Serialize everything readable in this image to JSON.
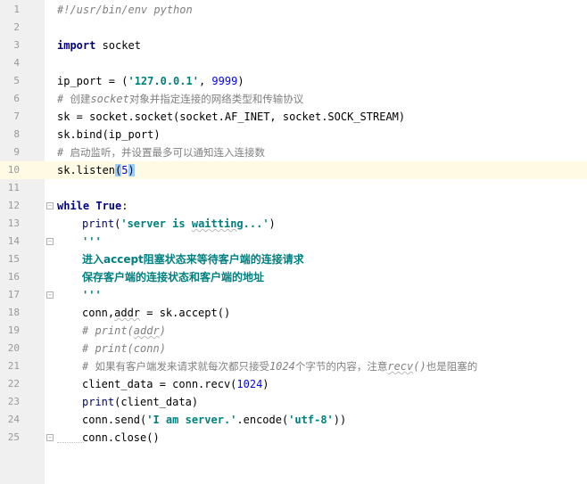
{
  "editor": {
    "current_line": 10,
    "lines": [
      {
        "n": "1",
        "tokens": [
          {
            "t": "#!/usr/bin/env python",
            "c": "cmt"
          }
        ]
      },
      {
        "n": "2",
        "tokens": []
      },
      {
        "n": "3",
        "tokens": [
          {
            "t": "import",
            "c": "kw"
          },
          {
            "t": " socket",
            "c": "plain"
          }
        ]
      },
      {
        "n": "4",
        "tokens": []
      },
      {
        "n": "5",
        "tokens": [
          {
            "t": "ip_port = (",
            "c": "plain"
          },
          {
            "t": "'127.0.0.1'",
            "c": "str"
          },
          {
            "t": ", ",
            "c": "plain"
          },
          {
            "t": "9999",
            "c": "num"
          },
          {
            "t": ")",
            "c": "plain"
          }
        ]
      },
      {
        "n": "6",
        "tokens": [
          {
            "t": "# ",
            "c": "cmt"
          },
          {
            "t": "创建",
            "c": "cmt-cn"
          },
          {
            "t": "socket",
            "c": "cmt"
          },
          {
            "t": "对象并指定连接的网络类型和传输协议",
            "c": "cmt-cn"
          }
        ]
      },
      {
        "n": "7",
        "tokens": [
          {
            "t": "sk = socket.socket(socket.AF_INET, socket.SOCK_STREAM)",
            "c": "plain"
          }
        ]
      },
      {
        "n": "8",
        "tokens": [
          {
            "t": "sk.bind(ip_port)",
            "c": "plain"
          }
        ]
      },
      {
        "n": "9",
        "tokens": [
          {
            "t": "# ",
            "c": "cmt"
          },
          {
            "t": "启动监听，并设置最多可以通知连入连接数",
            "c": "cmt-cn"
          }
        ]
      },
      {
        "n": "10",
        "tokens": [
          {
            "t": "sk.listen",
            "c": "plain"
          },
          {
            "t": "(",
            "c": "plain hl-paren"
          },
          {
            "t": "5",
            "c": "num"
          },
          {
            "t": ")",
            "c": "plain hl-paren"
          }
        ]
      },
      {
        "n": "11",
        "tokens": []
      },
      {
        "n": "12",
        "tokens": [
          {
            "t": "while",
            "c": "kw"
          },
          {
            "t": " ",
            "c": "plain"
          },
          {
            "t": "True",
            "c": "kw"
          },
          {
            "t": ":",
            "c": "plain"
          }
        ]
      },
      {
        "n": "13",
        "indent": 1,
        "tokens": [
          {
            "t": "print",
            "c": "builtin"
          },
          {
            "t": "(",
            "c": "plain"
          },
          {
            "t": "'server is ",
            "c": "str"
          },
          {
            "t": "waitting",
            "c": "str squiggle"
          },
          {
            "t": "...'",
            "c": "str"
          },
          {
            "t": ")",
            "c": "plain"
          }
        ]
      },
      {
        "n": "14",
        "indent": 1,
        "tokens": [
          {
            "t": "'''",
            "c": "str"
          }
        ]
      },
      {
        "n": "15",
        "indent": 1,
        "tokens": [
          {
            "t": "进入accept阻塞状态来等待客户端的连接请求",
            "c": "docstr"
          }
        ]
      },
      {
        "n": "16",
        "indent": 1,
        "tokens": [
          {
            "t": "保存客户端的连接状态和客户端的地址",
            "c": "docstr"
          }
        ]
      },
      {
        "n": "17",
        "indent": 1,
        "tokens": [
          {
            "t": "'''",
            "c": "str"
          }
        ]
      },
      {
        "n": "18",
        "indent": 1,
        "tokens": [
          {
            "t": "conn,",
            "c": "plain"
          },
          {
            "t": "addr",
            "c": "plain squiggle"
          },
          {
            "t": " = sk.accept()",
            "c": "plain"
          }
        ]
      },
      {
        "n": "19",
        "indent": 1,
        "tokens": [
          {
            "t": "# print(",
            "c": "cmt"
          },
          {
            "t": "addr",
            "c": "cmt squiggle"
          },
          {
            "t": ")",
            "c": "cmt"
          }
        ]
      },
      {
        "n": "20",
        "indent": 1,
        "tokens": [
          {
            "t": "# print(conn)",
            "c": "cmt"
          }
        ]
      },
      {
        "n": "21",
        "indent": 1,
        "tokens": [
          {
            "t": "# ",
            "c": "cmt"
          },
          {
            "t": "如果有客户端发来请求就每次都只接受",
            "c": "cmt-cn"
          },
          {
            "t": "1024",
            "c": "cmt"
          },
          {
            "t": "个字节的内容，注意",
            "c": "cmt-cn"
          },
          {
            "t": "recv",
            "c": "cmt squiggle"
          },
          {
            "t": "()",
            "c": "cmt"
          },
          {
            "t": "也是阻塞的",
            "c": "cmt-cn"
          }
        ]
      },
      {
        "n": "22",
        "indent": 1,
        "tokens": [
          {
            "t": "client_data = conn.recv(",
            "c": "plain"
          },
          {
            "t": "1024",
            "c": "num"
          },
          {
            "t": ")",
            "c": "plain"
          }
        ]
      },
      {
        "n": "23",
        "indent": 1,
        "tokens": [
          {
            "t": "print",
            "c": "builtin"
          },
          {
            "t": "(client_data)",
            "c": "plain"
          }
        ]
      },
      {
        "n": "24",
        "indent": 1,
        "tokens": [
          {
            "t": "conn.send(",
            "c": "plain"
          },
          {
            "t": "'I am server.'",
            "c": "str"
          },
          {
            "t": ".encode(",
            "c": "plain"
          },
          {
            "t": "'utf-8'",
            "c": "str"
          },
          {
            "t": "))",
            "c": "plain"
          }
        ]
      },
      {
        "n": "25",
        "indent": 1,
        "tokens": [
          {
            "t": "conn.close()",
            "c": "plain"
          }
        ]
      }
    ]
  },
  "colors": {
    "comment": "#808080",
    "keyword": "#000080",
    "string": "#008080",
    "number": "#0000ff",
    "current_line_bg": "#fffae3",
    "gutter_bg": "#f0f0f0"
  },
  "icons": {
    "fold_open": "fold-open-icon",
    "fold_end": "fold-end-icon"
  }
}
